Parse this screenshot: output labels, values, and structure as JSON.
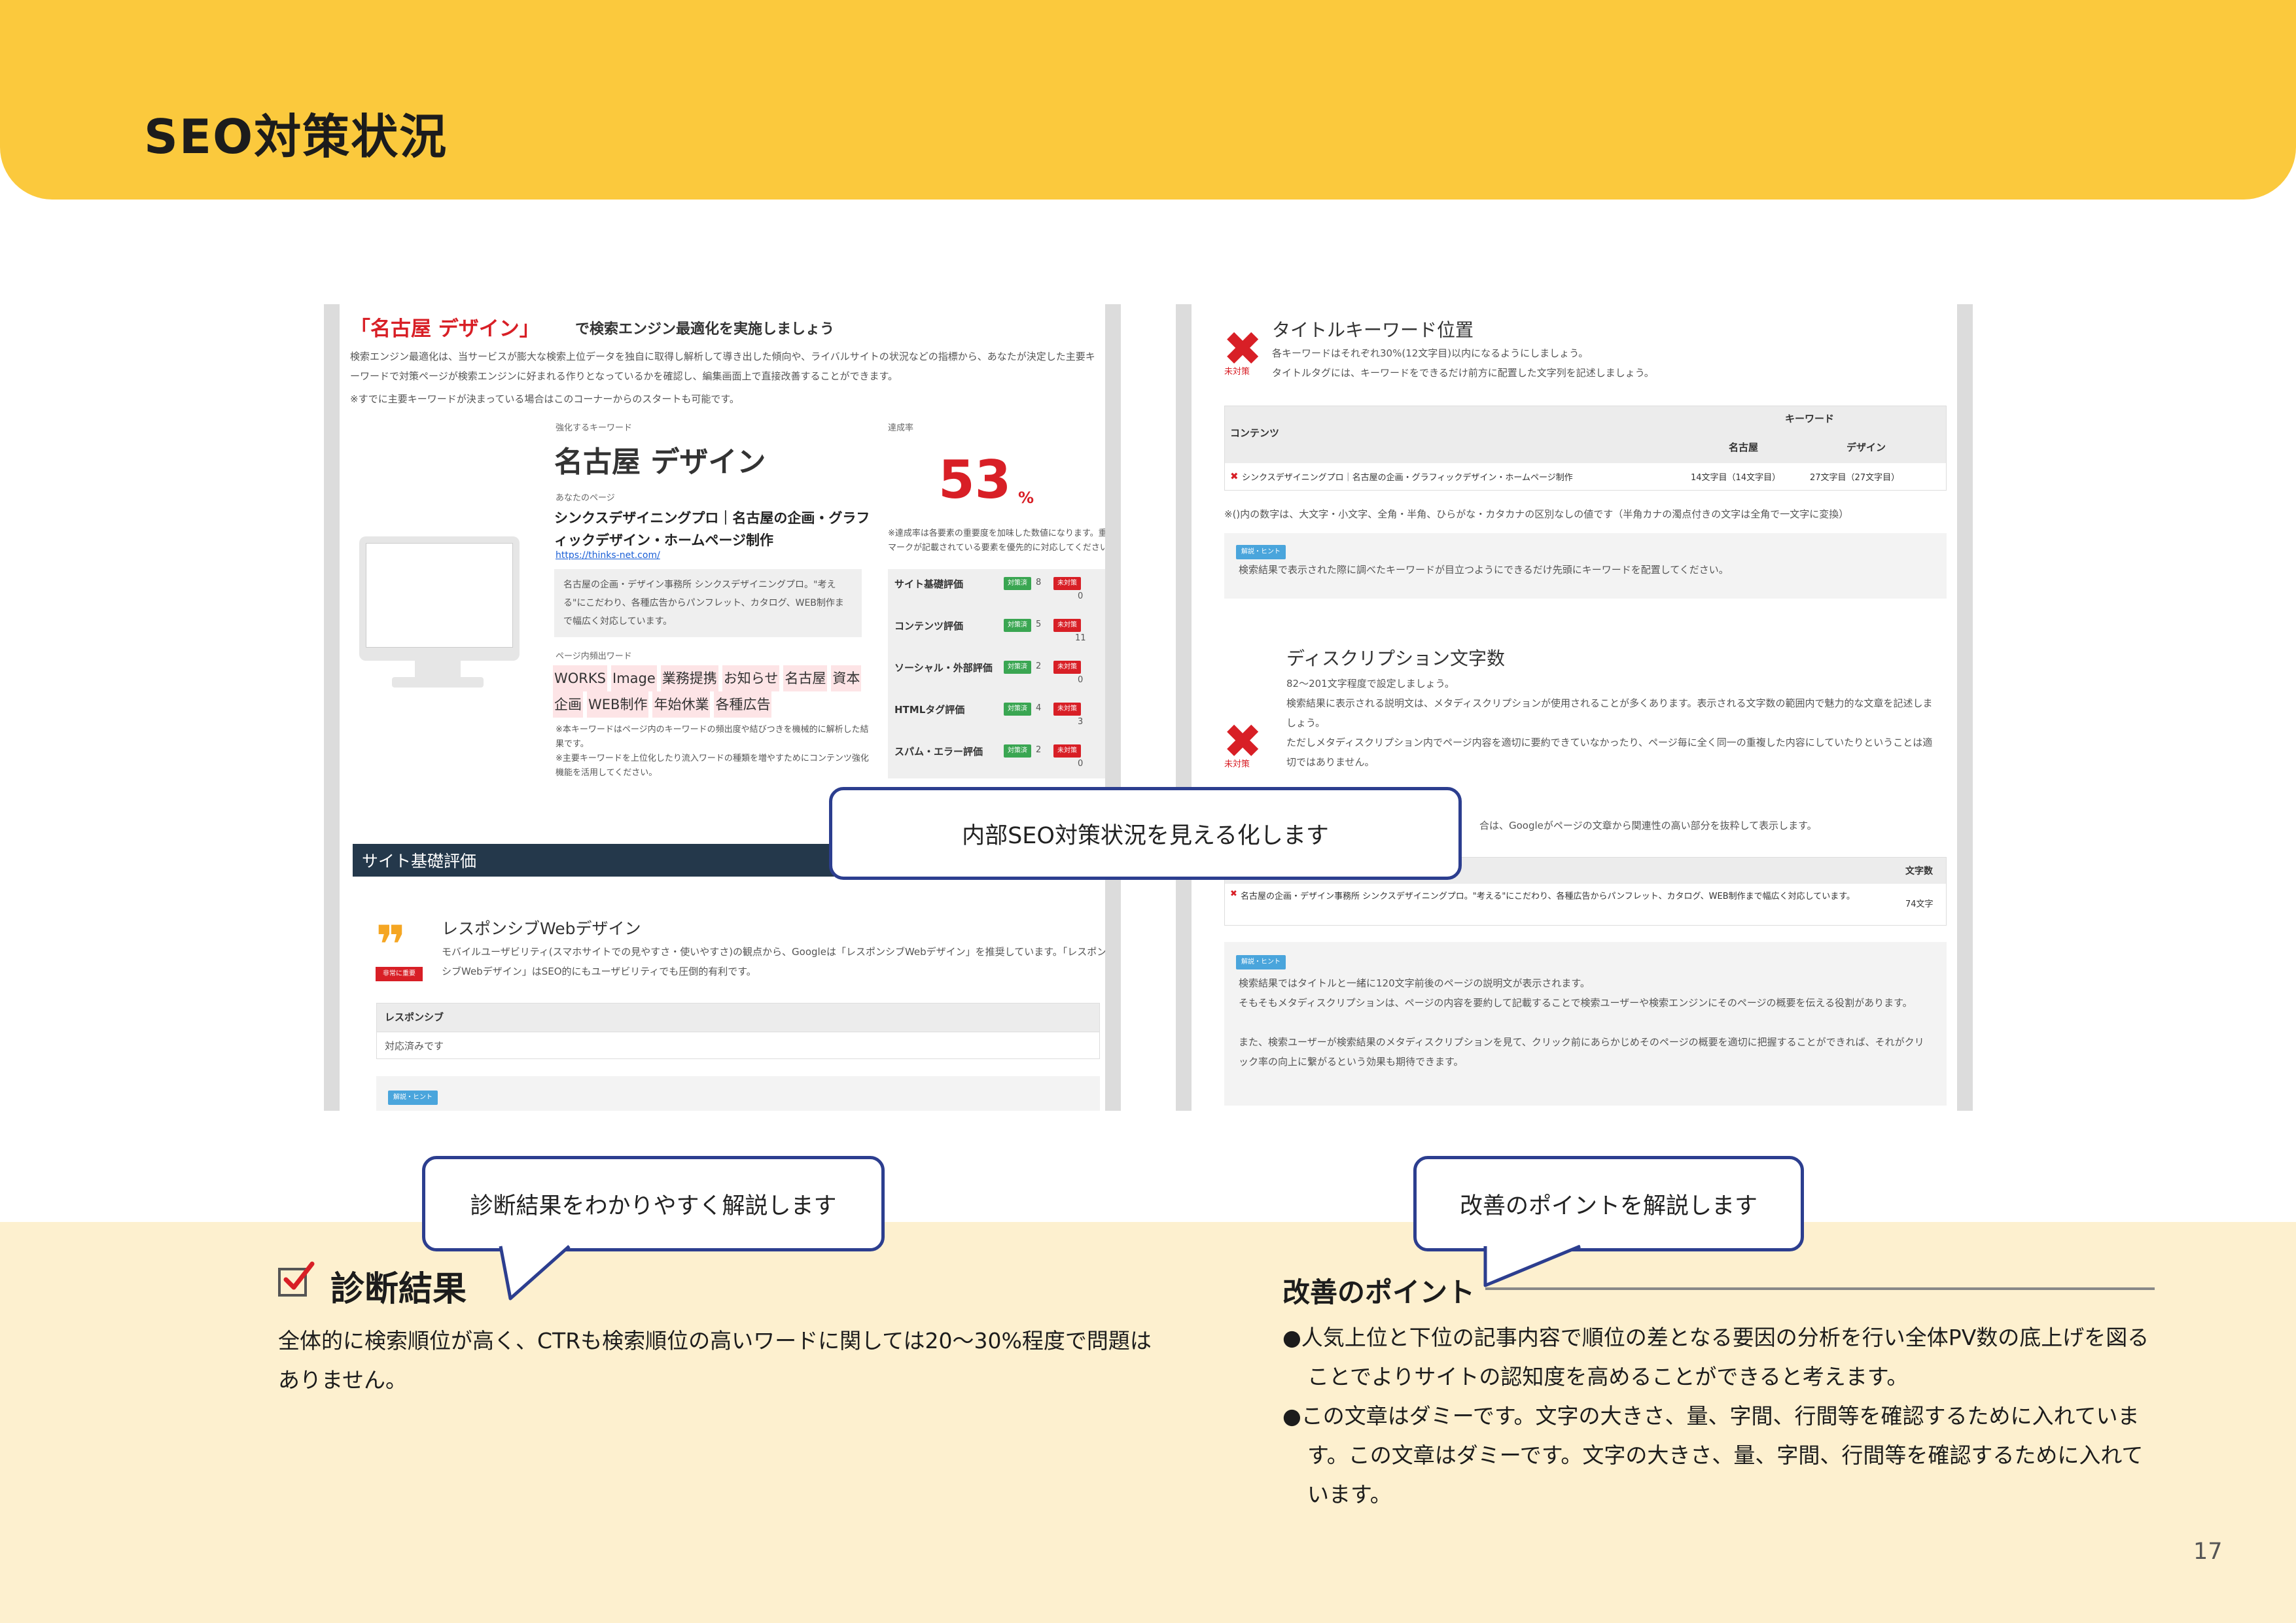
{
  "page": {
    "title": "SEO対策状況",
    "number": "17"
  },
  "left_panel": {
    "heading_highlight": "「名古屋 デザイン」",
    "heading_rest": "で検索エンジン最適化を実施しましょう",
    "intro": "検索エンジン最適化は、当サービスが膨大な検索上位データを独自に取得し解析して導き出した傾向や、ライバルサイトの状況などの指標から、あなたが決定した主要キーワードで対策ページが検索エンジンに好まれる作りとなっているかを確認し、編集画面上で直接改善することができます。",
    "note": "※すでに主要キーワードが決まっている場合はこのコーナーからのスタートも可能です。",
    "keyword_label": "強化するキーワード",
    "keyword": "名古屋 デザイン",
    "page_label": "あなたのページ",
    "page_title": "シンクスデザイニングプロ｜名古屋の企画・グラフィックデザイン・ホームページ制作",
    "url": "https://thinks-net.com/",
    "page_desc": "名古屋の企画・デザイン事務所 シンクスデザイニングプロ。\"考える\"にこだわり、各種広告からパンフレット、カタログ、WEB制作まで幅広く対応しています。",
    "words_label": "ページ内頻出ワード",
    "words": [
      "WORKS",
      "Image",
      "業務提携",
      "お知らせ",
      "名古屋",
      "資本",
      "企画",
      "WEB制作",
      "年始休業",
      "各種広告"
    ],
    "words_note": "※本キーワードはページ内のキーワードの頻出度や結びつきを機械的に解析した結果です。\n※主要キーワードを上位化したり流入ワードの種類を増やすためにコンテンツ強化機能を活用してください。",
    "rate_label": "達成率",
    "rate_value": "53",
    "rate_unit": "%",
    "rate_note": "※達成率は各要素の重要度を加味した数値になります。重要マークが記載されている要素を優先的に対応してください。",
    "tag_ok": "対策済",
    "tag_ng": "未対策",
    "scores": [
      {
        "name": "サイト基礎評価",
        "ok": "8",
        "ng": "0"
      },
      {
        "name": "コンテンツ評価",
        "ok": "5",
        "ng": "11"
      },
      {
        "name": "ソーシャル・外部評価",
        "ok": "2",
        "ng": "0"
      },
      {
        "name": "HTMLタグ評価",
        "ok": "4",
        "ng": "3"
      },
      {
        "name": "スパム・エラー評価",
        "ok": "2",
        "ng": "0"
      }
    ],
    "site_bar": "サイト基礎評価",
    "badge_important": "非常に重要",
    "resp_title": "レスポンシブWebデザイン",
    "resp_text": "モバイルユーザビリティ(スマホサイトでの見やすさ・使いやすさ)の観点から、Googleは「レスポンシブWebデザイン」を推奨しています。「レスポンシブWebデザイン」はSEO的にもユーザビリティでも圧倒的有利です。",
    "resp_table_head": "レスポンシブ",
    "resp_table_cell": "対応済みです",
    "hint_label": "解説・ヒント"
  },
  "right_panel": {
    "status_label": "未対策",
    "section1_title": "タイトルキーワード位置",
    "section1_text": "各キーワードはそれぞれ30%(12文字目)以内になるようにしましょう。\nタイトルタグには、キーワードをできるだけ前方に配置した文字列を記述しましょう。",
    "table1": {
      "col_content": "コンテンツ",
      "col_keyword": "キーワード",
      "col_k1": "名古屋",
      "col_k2": "デザイン",
      "row": "シンクスデザイニングプロ｜名古屋の企画・グラフィックデザイン・ホームページ制作",
      "v1": "14文字目（14文字目）",
      "v2": "27文字目（27文字目）"
    },
    "table1_note": "※()内の数字は、大文字・小文字、全角・半角、ひらがな・カタカナの区別なしの値です（半角カナの濁点付きの文字は全角で一文字に変換）",
    "hint_label": "解説・ヒント",
    "hint1_text": "検索結果で表示された際に調べたキーワードが目立つようにできるだけ先頭にキーワードを配置してください。",
    "section2_title": "ディスクリプション文字数",
    "section2_text": "82〜201文字程度で設定しましょう。\n検索結果に表示される説明文は、メタディスクリプションが使用されることが多くあります。表示される文字数の範囲内で魅力的な文章を記述しましょう。\nただしメタディスクリプション内でページ内容を適切に要約できていなかったり、ページ毎に全く同一の重複した内容にしていたりということは適切ではありません。",
    "section2_tail": "合は、Googleがページの文章から関連性の高い部分を抜粋して表示します。",
    "table2": {
      "col_count": "文字数",
      "row": "名古屋の企画・デザイン事務所 シンクスデザイニングプロ。\"考える\"にこだわり、各種広告からパンフレット、カタログ、WEB制作まで幅広く対応しています。",
      "value": "74文字"
    },
    "hint2_text": "検索結果ではタイトルと一緒に120文字前後のページの説明文が表示されます。\nそもそもメタディスクリプションは、ページの内容を要約して記載することで検索ユーザーや検索エンジンにそのページの概要を伝える役割があります。\n\nまた、検索ユーザーが検索結果のメタディスクリプションを見て、クリック前にあらかじめそのページの概要を適切に把握することができれば、それがクリック率の向上に繋がるという効果も期待できます。"
  },
  "bubbles": {
    "center": "内部SEO対策状況を見える化します",
    "left": "診断結果をわかりやすく解説します",
    "right": "改善のポイントを解説します"
  },
  "diagnosis": {
    "title": "診断結果",
    "text": "全体的に検索順位が高く、CTRも検索順位の高いワードに関しては20〜30%程度で問題はありません。"
  },
  "improvement": {
    "title": "改善のポイント",
    "items": [
      "●人気上位と下位の記事内容で順位の差となる要因の分析を行い全体PV数の底上げを図ることでよりサイトの認知度を高めることができると考えます。",
      "●この文章はダミーです。文字の大きさ、量、字間、行間等を確認するために入れています。この文章はダミーです。文字の大きさ、量、字間、行間等を確認するために入れています。"
    ]
  },
  "colors": {
    "header": "#fbc93d",
    "bottom": "#fdf0cf",
    "accent_red": "#d81f26",
    "bubble_border": "#2c3e8f",
    "site_bar": "#24384b"
  }
}
